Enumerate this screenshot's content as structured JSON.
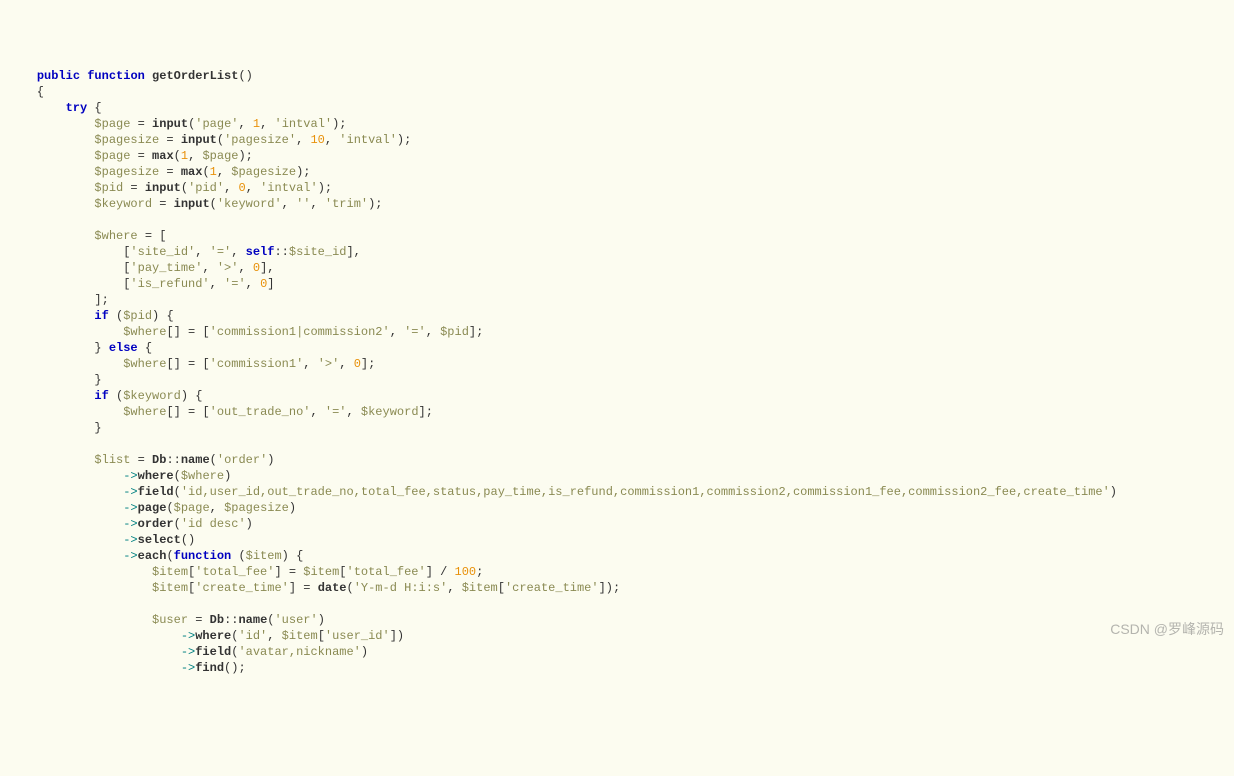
{
  "code": {
    "l1": {
      "kw1": "public",
      "kw2": "function",
      "name": "getOrderList"
    },
    "l3": {
      "kw": "try"
    },
    "l4": {
      "v": "$page",
      "fn": "input",
      "s1": "'page'",
      "n": "1",
      "s2": "'intval'"
    },
    "l5": {
      "v": "$pagesize",
      "fn": "input",
      "s1": "'pagesize'",
      "n": "10",
      "s2": "'intval'"
    },
    "l6": {
      "v": "$page",
      "fn": "max",
      "n": "1",
      "v2": "$page"
    },
    "l7": {
      "v": "$pagesize",
      "fn": "max",
      "n": "1",
      "v2": "$pagesize"
    },
    "l8": {
      "v": "$pid",
      "fn": "input",
      "s1": "'pid'",
      "n": "0",
      "s2": "'intval'"
    },
    "l9": {
      "v": "$keyword",
      "fn": "input",
      "s1": "'keyword'",
      "s2": "''",
      "s3": "'trim'"
    },
    "l11": {
      "v": "$where"
    },
    "l12": {
      "s1": "'site_id'",
      "s2": "'='",
      "kw": "self",
      "v": "$site_id"
    },
    "l13": {
      "s1": "'pay_time'",
      "s2": "'>'",
      "n": "0"
    },
    "l14": {
      "s1": "'is_refund'",
      "s2": "'='",
      "n": "0"
    },
    "l16": {
      "kw": "if",
      "v": "$pid"
    },
    "l17": {
      "v": "$where",
      "s1": "'commission1|commission2'",
      "s2": "'='",
      "v2": "$pid"
    },
    "l18": {
      "kw": "else"
    },
    "l19": {
      "v": "$where",
      "s1": "'commission1'",
      "s2": "'>'",
      "n": "0"
    },
    "l21": {
      "kw": "if",
      "v": "$keyword"
    },
    "l22": {
      "v": "$where",
      "s1": "'out_trade_no'",
      "s2": "'='",
      "v2": "$keyword"
    },
    "l25": {
      "v": "$list",
      "cls": "Db",
      "fn": "name",
      "s": "'order'"
    },
    "l26": {
      "fn": "where",
      "v": "$where"
    },
    "l27": {
      "fn": "field",
      "s": "'id,user_id,out_trade_no,total_fee,status,pay_time,is_refund,commission1,commission2,commission1_fee,commission2_fee,create_time'"
    },
    "l28": {
      "fn": "page",
      "v1": "$page",
      "v2": "$pagesize"
    },
    "l29": {
      "fn": "order",
      "s": "'id desc'"
    },
    "l30": {
      "fn": "select"
    },
    "l31": {
      "fn": "each",
      "kw": "function",
      "v": "$item"
    },
    "l32": {
      "v": "$item",
      "s1": "'total_fee'",
      "v2": "$item",
      "s2": "'total_fee'",
      "n": "100"
    },
    "l33": {
      "v": "$item",
      "s1": "'create_time'",
      "fn": "date",
      "s2": "'Y-m-d H:i:s'",
      "v2": "$item",
      "s3": "'create_time'"
    },
    "l35": {
      "v": "$user",
      "cls": "Db",
      "fn": "name",
      "s": "'user'"
    },
    "l36": {
      "fn": "where",
      "s": "'id'",
      "v": "$item",
      "s2": "'user_id'"
    },
    "l37": {
      "fn": "field",
      "s": "'avatar,nickname'"
    },
    "l38": {
      "fn": "find"
    }
  },
  "watermark": "CSDN @罗峰源码"
}
